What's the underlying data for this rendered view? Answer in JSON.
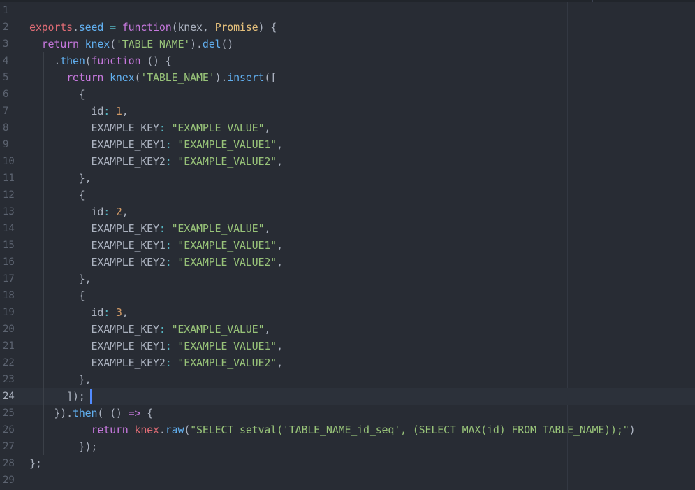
{
  "editor": {
    "cursor_line": 24,
    "colors": {
      "background": "#282c34",
      "cursor_line_bg": "#2c313a",
      "cursor": "#528bff",
      "keyword": "#c678dd",
      "string": "#98c379",
      "number": "#d19a66",
      "variable": "#e06c75",
      "function": "#61afef",
      "class": "#e5c07b",
      "operator": "#56b6c2",
      "plain": "#abb2bf",
      "gutter": "#5c6370"
    },
    "lines": [
      {
        "num": "1",
        "tokens": []
      },
      {
        "num": "2",
        "tokens": [
          {
            "t": "exports",
            "c": "var"
          },
          {
            "t": ".",
            "c": "plain"
          },
          {
            "t": "seed",
            "c": "prop"
          },
          {
            "t": " = ",
            "c": "op"
          },
          {
            "t": "function",
            "c": "kw"
          },
          {
            "t": "(knex, ",
            "c": "plain"
          },
          {
            "t": "Promise",
            "c": "cls"
          },
          {
            "t": ") {",
            "c": "plain"
          }
        ]
      },
      {
        "num": "3",
        "tokens": [
          {
            "t": "  ",
            "c": "plain"
          },
          {
            "t": "return",
            "c": "kw"
          },
          {
            "t": " ",
            "c": "plain"
          },
          {
            "t": "knex",
            "c": "fn"
          },
          {
            "t": "(",
            "c": "plain"
          },
          {
            "t": "'TABLE_NAME'",
            "c": "str"
          },
          {
            "t": ").",
            "c": "plain"
          },
          {
            "t": "del",
            "c": "fn"
          },
          {
            "t": "()",
            "c": "plain"
          }
        ]
      },
      {
        "num": "4",
        "tokens": [
          {
            "t": "    .",
            "c": "plain"
          },
          {
            "t": "then",
            "c": "fn"
          },
          {
            "t": "(",
            "c": "plain"
          },
          {
            "t": "function",
            "c": "kw"
          },
          {
            "t": " () {",
            "c": "plain"
          }
        ]
      },
      {
        "num": "5",
        "tokens": [
          {
            "t": "      ",
            "c": "plain"
          },
          {
            "t": "return",
            "c": "kw"
          },
          {
            "t": " ",
            "c": "plain"
          },
          {
            "t": "knex",
            "c": "fn"
          },
          {
            "t": "(",
            "c": "plain"
          },
          {
            "t": "'TABLE_NAME'",
            "c": "str"
          },
          {
            "t": ").",
            "c": "plain"
          },
          {
            "t": "insert",
            "c": "fn"
          },
          {
            "t": "([",
            "c": "plain"
          }
        ]
      },
      {
        "num": "6",
        "tokens": [
          {
            "t": "        {",
            "c": "plain"
          }
        ]
      },
      {
        "num": "7",
        "tokens": [
          {
            "t": "          id",
            "c": "plain"
          },
          {
            "t": ": ",
            "c": "op"
          },
          {
            "t": "1",
            "c": "num"
          },
          {
            "t": ",",
            "c": "plain"
          }
        ]
      },
      {
        "num": "8",
        "tokens": [
          {
            "t": "          EXAMPLE_KEY",
            "c": "plain"
          },
          {
            "t": ": ",
            "c": "op"
          },
          {
            "t": "\"EXAMPLE_VALUE\"",
            "c": "str"
          },
          {
            "t": ",",
            "c": "plain"
          }
        ]
      },
      {
        "num": "9",
        "tokens": [
          {
            "t": "          EXAMPLE_KEY1",
            "c": "plain"
          },
          {
            "t": ": ",
            "c": "op"
          },
          {
            "t": "\"EXAMPLE_VALUE1\"",
            "c": "str"
          },
          {
            "t": ",",
            "c": "plain"
          }
        ]
      },
      {
        "num": "10",
        "tokens": [
          {
            "t": "          EXAMPLE_KEY2",
            "c": "plain"
          },
          {
            "t": ": ",
            "c": "op"
          },
          {
            "t": "\"EXAMPLE_VALUE2\"",
            "c": "str"
          },
          {
            "t": ",",
            "c": "plain"
          }
        ]
      },
      {
        "num": "11",
        "tokens": [
          {
            "t": "        },",
            "c": "plain"
          }
        ]
      },
      {
        "num": "12",
        "tokens": [
          {
            "t": "        {",
            "c": "plain"
          }
        ]
      },
      {
        "num": "13",
        "tokens": [
          {
            "t": "          id",
            "c": "plain"
          },
          {
            "t": ": ",
            "c": "op"
          },
          {
            "t": "2",
            "c": "num"
          },
          {
            "t": ",",
            "c": "plain"
          }
        ]
      },
      {
        "num": "14",
        "tokens": [
          {
            "t": "          EXAMPLE_KEY",
            "c": "plain"
          },
          {
            "t": ": ",
            "c": "op"
          },
          {
            "t": "\"EXAMPLE_VALUE\"",
            "c": "str"
          },
          {
            "t": ",",
            "c": "plain"
          }
        ]
      },
      {
        "num": "15",
        "tokens": [
          {
            "t": "          EXAMPLE_KEY1",
            "c": "plain"
          },
          {
            "t": ": ",
            "c": "op"
          },
          {
            "t": "\"EXAMPLE_VALUE1\"",
            "c": "str"
          },
          {
            "t": ",",
            "c": "plain"
          }
        ]
      },
      {
        "num": "16",
        "tokens": [
          {
            "t": "          EXAMPLE_KEY2",
            "c": "plain"
          },
          {
            "t": ": ",
            "c": "op"
          },
          {
            "t": "\"EXAMPLE_VALUE2\"",
            "c": "str"
          },
          {
            "t": ",",
            "c": "plain"
          }
        ]
      },
      {
        "num": "17",
        "tokens": [
          {
            "t": "        },",
            "c": "plain"
          }
        ]
      },
      {
        "num": "18",
        "tokens": [
          {
            "t": "        {",
            "c": "plain"
          }
        ]
      },
      {
        "num": "19",
        "tokens": [
          {
            "t": "          id",
            "c": "plain"
          },
          {
            "t": ": ",
            "c": "op"
          },
          {
            "t": "3",
            "c": "num"
          },
          {
            "t": ",",
            "c": "plain"
          }
        ]
      },
      {
        "num": "20",
        "tokens": [
          {
            "t": "          EXAMPLE_KEY",
            "c": "plain"
          },
          {
            "t": ": ",
            "c": "op"
          },
          {
            "t": "\"EXAMPLE_VALUE\"",
            "c": "str"
          },
          {
            "t": ",",
            "c": "plain"
          }
        ]
      },
      {
        "num": "21",
        "tokens": [
          {
            "t": "          EXAMPLE_KEY1",
            "c": "plain"
          },
          {
            "t": ": ",
            "c": "op"
          },
          {
            "t": "\"EXAMPLE_VALUE1\"",
            "c": "str"
          },
          {
            "t": ",",
            "c": "plain"
          }
        ]
      },
      {
        "num": "22",
        "tokens": [
          {
            "t": "          EXAMPLE_KEY2",
            "c": "plain"
          },
          {
            "t": ": ",
            "c": "op"
          },
          {
            "t": "\"EXAMPLE_VALUE2\"",
            "c": "str"
          },
          {
            "t": ",",
            "c": "plain"
          }
        ]
      },
      {
        "num": "23",
        "tokens": [
          {
            "t": "        },",
            "c": "plain"
          }
        ]
      },
      {
        "num": "24",
        "tokens": [
          {
            "t": "      ]);",
            "c": "plain"
          }
        ]
      },
      {
        "num": "25",
        "tokens": [
          {
            "t": "    }).",
            "c": "plain"
          },
          {
            "t": "then",
            "c": "fn"
          },
          {
            "t": "( () ",
            "c": "plain"
          },
          {
            "t": "=>",
            "c": "kw"
          },
          {
            "t": " {",
            "c": "plain"
          }
        ]
      },
      {
        "num": "26",
        "tokens": [
          {
            "t": "          ",
            "c": "plain"
          },
          {
            "t": "return",
            "c": "kw"
          },
          {
            "t": " ",
            "c": "plain"
          },
          {
            "t": "knex",
            "c": "var"
          },
          {
            "t": ".",
            "c": "plain"
          },
          {
            "t": "raw",
            "c": "fn"
          },
          {
            "t": "(",
            "c": "plain"
          },
          {
            "t": "\"SELECT setval('TABLE_NAME_id_seq', (SELECT MAX(id) FROM TABLE_NAME));\"",
            "c": "str"
          },
          {
            "t": ")",
            "c": "plain"
          }
        ]
      },
      {
        "num": "27",
        "tokens": [
          {
            "t": "        });",
            "c": "plain"
          }
        ]
      },
      {
        "num": "28",
        "tokens": [
          {
            "t": "};",
            "c": "plain"
          }
        ]
      },
      {
        "num": "29",
        "tokens": []
      }
    ]
  }
}
